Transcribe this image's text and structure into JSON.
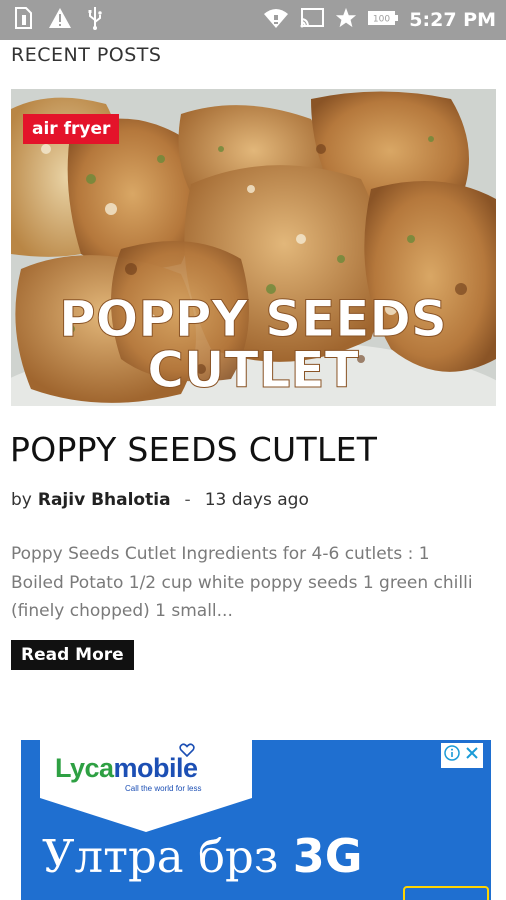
{
  "status_bar": {
    "time": "5:27 PM",
    "battery": "100",
    "icons": [
      "sim-card-icon",
      "warning-icon",
      "usb-icon",
      "wifi-icon",
      "cast-icon",
      "star-icon",
      "battery-icon"
    ]
  },
  "section": {
    "title": "RECENT POSTS"
  },
  "post": {
    "tag": "air fryer",
    "image_text_line1": "POPPY SEEDS",
    "image_text_line2": "CUTLET",
    "title": "POPPY SEEDS CUTLET",
    "by": "by",
    "author": "Rajiv Bhalotia",
    "separator": "-",
    "time_ago": "13 days ago",
    "excerpt_lines": [
      "Poppy Seeds Cutlet Ingredients for 4-6 cutlets : 1",
      "Boiled Potato 1/2 cup white poppy seeds 1 green chilli",
      "(finely chopped) 1 small..."
    ],
    "read_more": "Read More"
  },
  "ad": {
    "brand_part1": "Lyca",
    "brand_part2": "mobile",
    "tagline": "Call the world for less",
    "headline": "Ултра брз",
    "headline_bold": "3G",
    "colors": {
      "background": "#1f6fd0",
      "brand_green": "#2ea043",
      "brand_blue": "#1c4fb4"
    }
  },
  "colors": {
    "tag_red": "#e4132a",
    "status_bar": "#9e9e9e",
    "button_black": "#111111"
  }
}
